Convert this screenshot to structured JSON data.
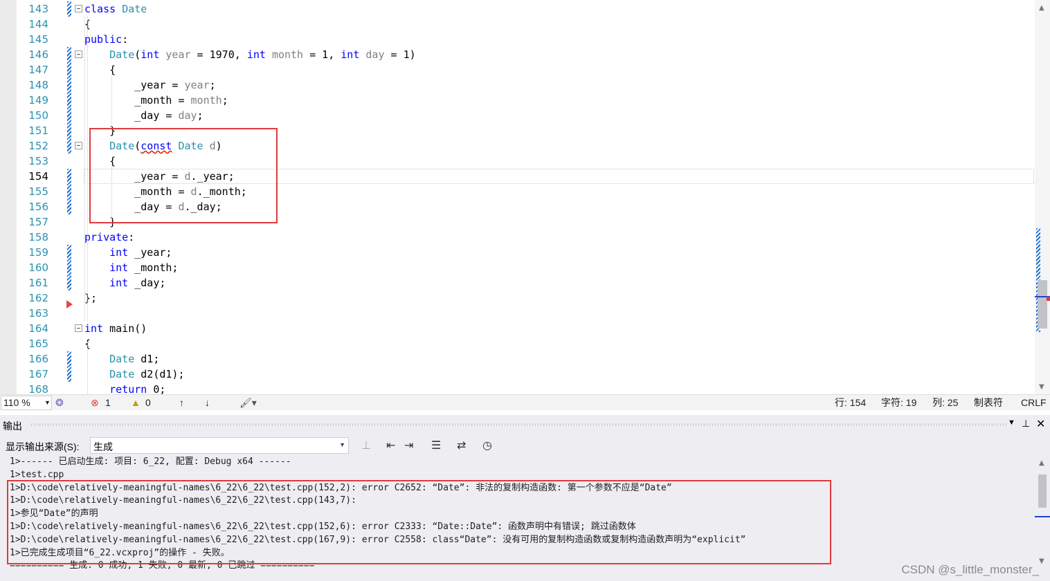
{
  "editor": {
    "lines": [
      {
        "n": "143",
        "html": "<span class='kw'>class</span> <span class='ty'>Date</span>"
      },
      {
        "n": "144",
        "html": "{"
      },
      {
        "n": "145",
        "html": "<span class='kw'>public</span>:"
      },
      {
        "n": "146",
        "html": "    <span class='ty'>Date</span>(<span class='kw'>int</span> <span class='pm'>year</span> = 1970, <span class='kw'>int</span> <span class='pm'>month</span> = 1, <span class='kw'>int</span> <span class='pm'>day</span> = 1)"
      },
      {
        "n": "147",
        "html": "    {"
      },
      {
        "n": "148",
        "html": "        _year = <span class='pm'>year</span>;"
      },
      {
        "n": "149",
        "html": "        _month = <span class='pm'>month</span>;"
      },
      {
        "n": "150",
        "html": "        _day = <span class='pm'>day</span>;"
      },
      {
        "n": "151",
        "html": "    }"
      },
      {
        "n": "152",
        "html": "    <span class='ty'>Date</span>(<span class='kw sq'>const</span> <span class='ty'>Date</span> <span class='pm'>d</span>)"
      },
      {
        "n": "153",
        "html": "    {"
      },
      {
        "n": "154",
        "html": "        _year = <span class='pm'>d</span>._year;"
      },
      {
        "n": "155",
        "html": "        _month = <span class='pm'>d</span>._month;"
      },
      {
        "n": "156",
        "html": "        _day = <span class='pm'>d</span>._day;"
      },
      {
        "n": "157",
        "html": "    }"
      },
      {
        "n": "158",
        "html": "<span class='kw'>private</span>:"
      },
      {
        "n": "159",
        "html": "    <span class='kw'>int</span> _year;"
      },
      {
        "n": "160",
        "html": "    <span class='kw'>int</span> _month;"
      },
      {
        "n": "161",
        "html": "    <span class='kw'>int</span> _day;"
      },
      {
        "n": "162",
        "html": "};"
      },
      {
        "n": "163",
        "html": ""
      },
      {
        "n": "164",
        "html": "<span class='kw'>int</span> main()"
      },
      {
        "n": "165",
        "html": "{"
      },
      {
        "n": "166",
        "html": "    <span class='ty'>Date</span> d1;"
      },
      {
        "n": "167",
        "html": "    <span class='ty'>Date</span> d2(d1);"
      },
      {
        "n": "168",
        "html": "    <span class='kw'>return</span> 0;"
      }
    ]
  },
  "statusbar": {
    "zoom": "110 %",
    "errors": "1",
    "warnings": "0",
    "row": "行: 154",
    "char": "字符: 19",
    "col": "列: 25",
    "indent": "制表符",
    "eol": "CRLF"
  },
  "output": {
    "title": "输出",
    "source_label": "显示输出来源(S):",
    "source_value": "生成",
    "lines": [
      "1>------ 已启动生成: 项目: 6_22, 配置: Debug x64 ------",
      "1>test.cpp",
      "1>D:\\code\\relatively-meaningful-names\\6_22\\6_22\\test.cpp(152,2): error C2652: “Date”: 非法的复制构造函数: 第一个参数不应是“Date”",
      "1>D:\\code\\relatively-meaningful-names\\6_22\\6_22\\test.cpp(143,7):",
      "1>参见“Date”的声明",
      "1>D:\\code\\relatively-meaningful-names\\6_22\\6_22\\test.cpp(152,6): error C2333: “Date::Date”: 函数声明中有错误; 跳过函数体",
      "1>D:\\code\\relatively-meaningful-names\\6_22\\6_22\\test.cpp(167,9): error C2558: class“Date”: 没有可用的复制构造函数或复制构造函数声明为“explicit”",
      "1>已完成生成项目“6_22.vcxproj”的操作 - 失败。",
      "========== 生成: 0 成功, 1 失败, 0 最新, 0 已跳过 =========="
    ]
  },
  "watermark": "CSDN @s_little_monster_",
  "colors": {
    "keyword": "#0000ff",
    "type": "#2b91af",
    "param": "#808080",
    "highlight_box": "#e03a3a"
  }
}
